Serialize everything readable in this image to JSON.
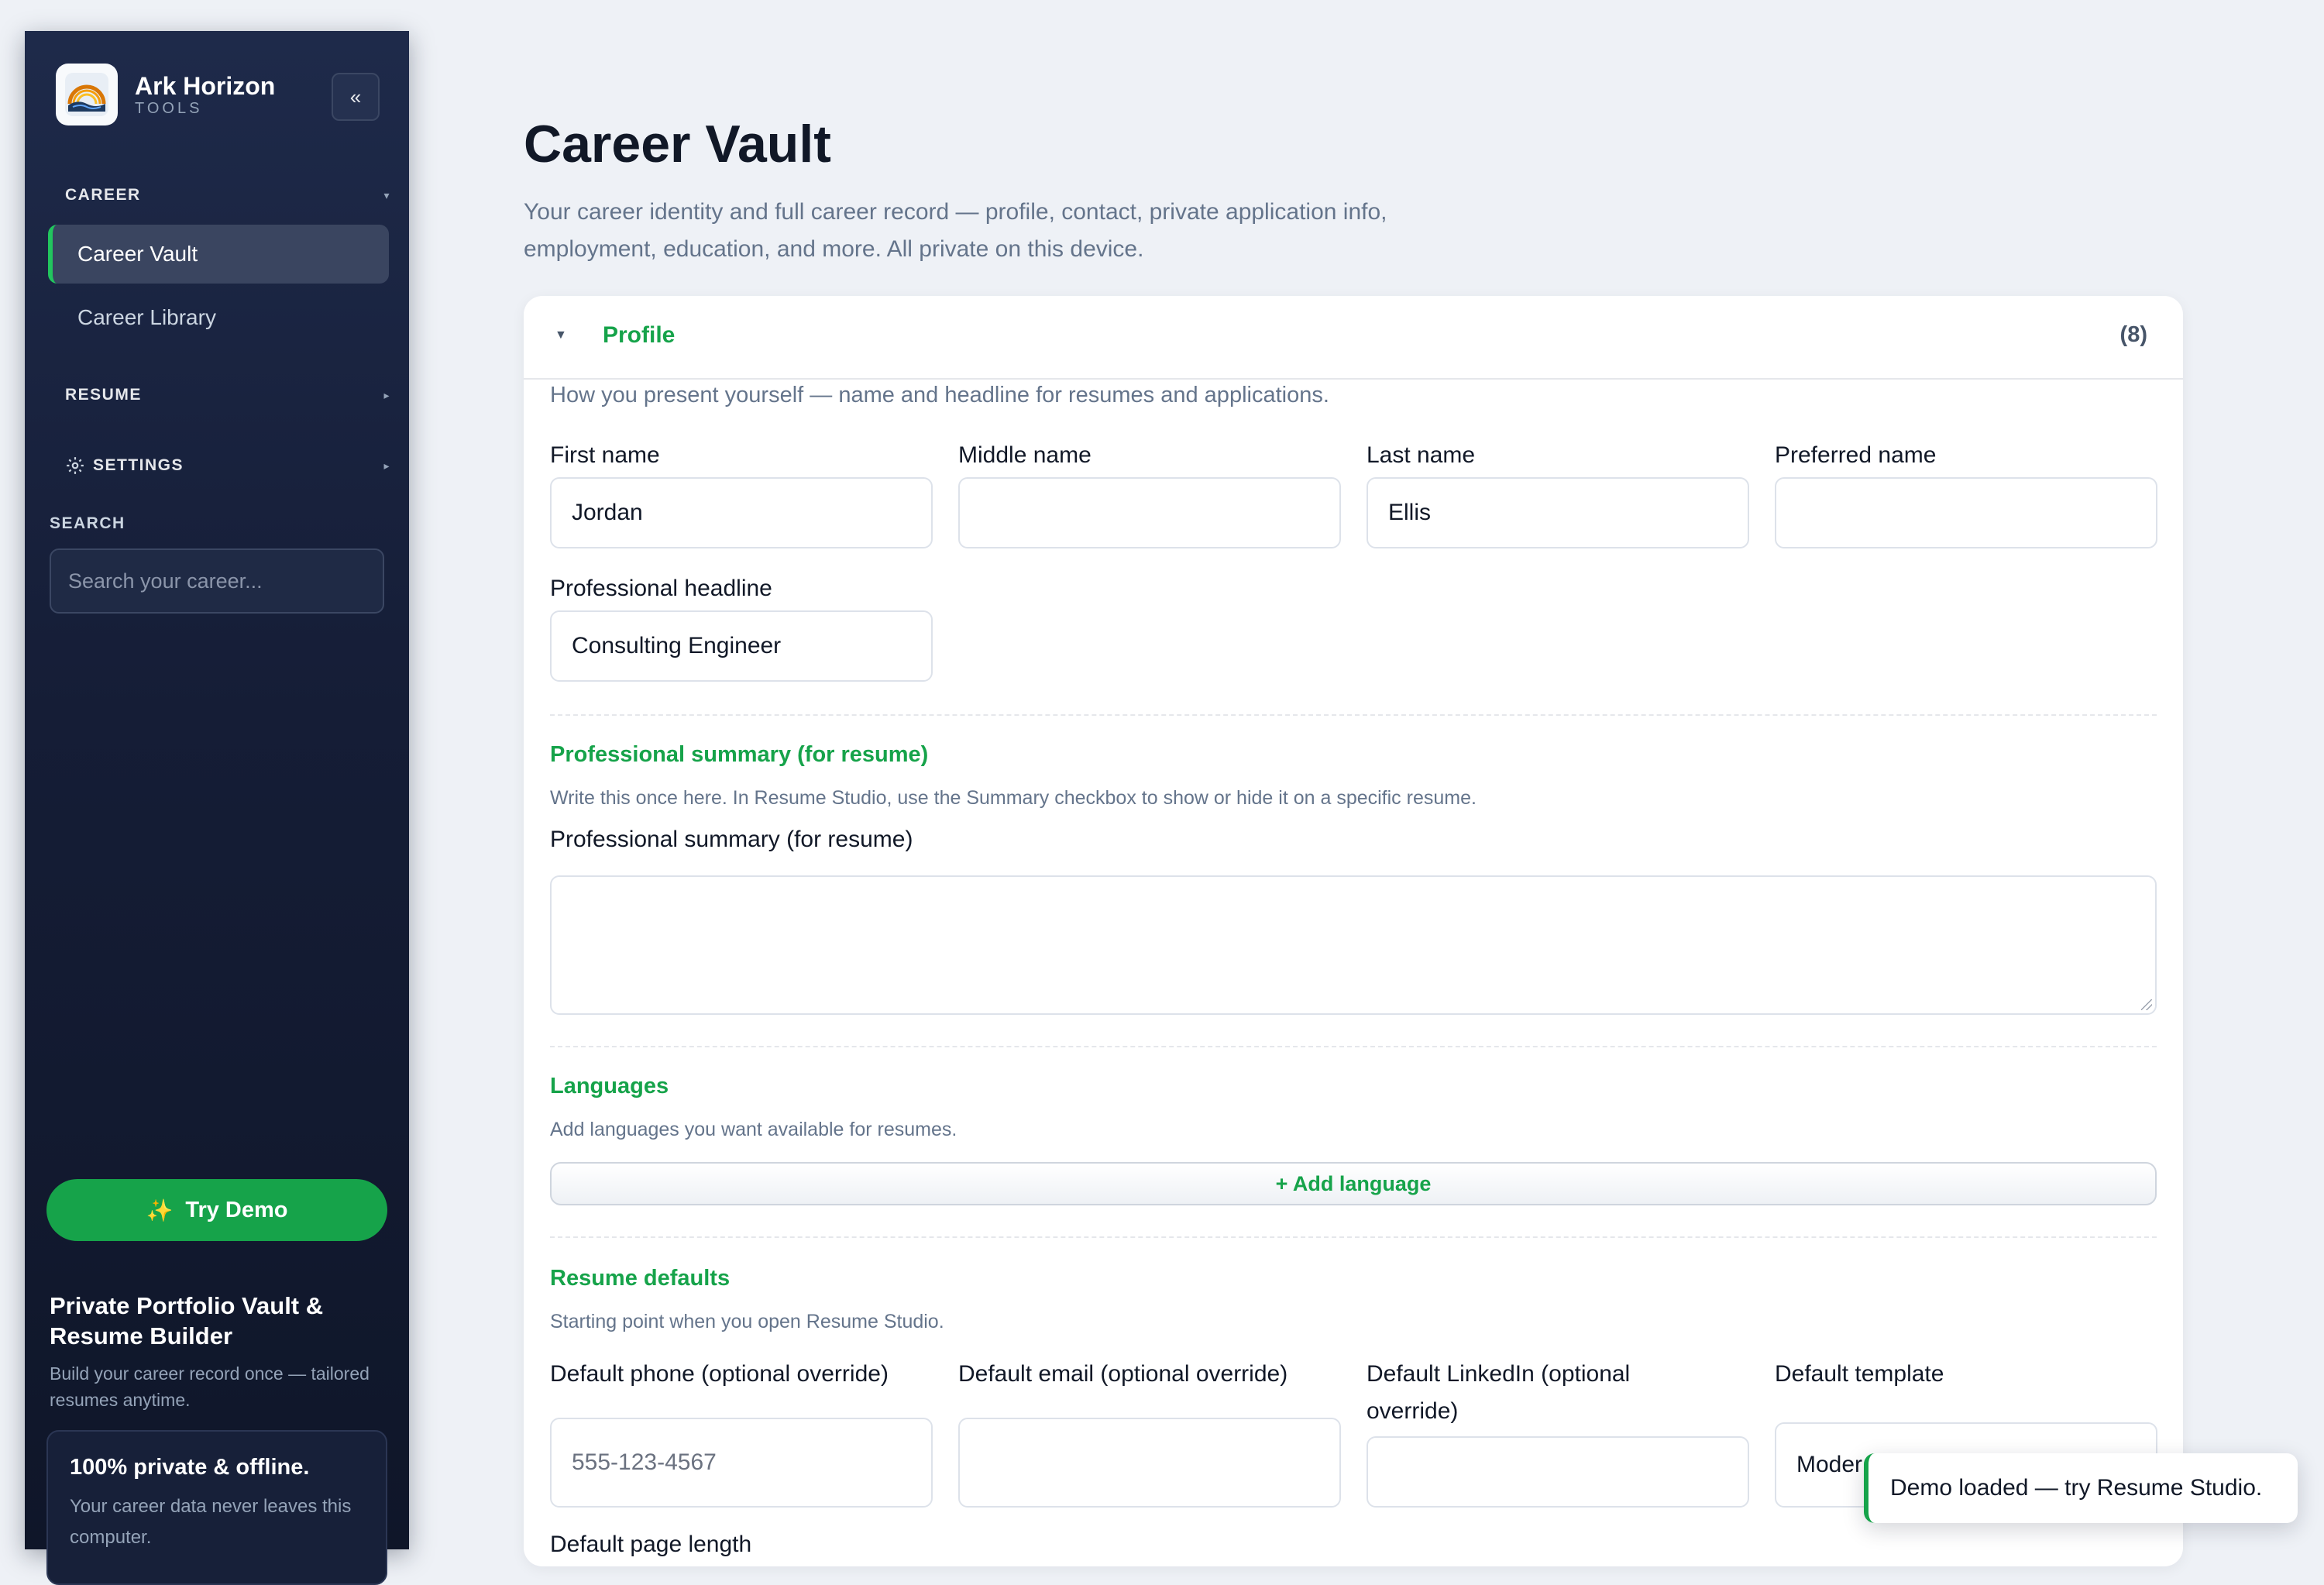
{
  "sidebar": {
    "brand_name": "Ark Horizon",
    "brand_sub": "TOOLS",
    "collapse_label": "«",
    "sections": {
      "career": "CAREER",
      "resume": "RESUME",
      "settings": "SETTINGS",
      "search": "SEARCH"
    },
    "items": [
      {
        "label": "Career Vault",
        "active": true
      },
      {
        "label": "Career Library",
        "active": false
      }
    ],
    "search_placeholder": "Search your career...",
    "try_demo": "Try Demo",
    "promo_title": "Private Portfolio Vault & Resume Builder",
    "promo_desc": "Build your career record once — tailored resumes anytime.",
    "private_title": "100% private & offline.",
    "private_desc": "Your career data never leaves this computer.",
    "accent_color": "#22c55e"
  },
  "main": {
    "title": "Career Vault",
    "description": "Your career identity and full career record — profile, contact, private application info, employment, education, and more. All private on this device."
  },
  "profile": {
    "title": "Profile",
    "count": "(8)",
    "intro": "How you present yourself — name and headline for resumes and applications.",
    "fields": {
      "first_name": {
        "label": "First name",
        "value": "Jordan"
      },
      "middle_name": {
        "label": "Middle name",
        "value": ""
      },
      "last_name": {
        "label": "Last name",
        "value": "Ellis"
      },
      "preferred_name": {
        "label": "Preferred name",
        "value": ""
      },
      "headline": {
        "label": "Professional headline",
        "value": "Consulting Engineer"
      }
    },
    "summary": {
      "title": "Professional summary (for resume)",
      "desc": "Write this once here. In Resume Studio, use the Summary checkbox to show or hide it on a specific resume.",
      "label": "Professional summary (for resume)",
      "value": ""
    },
    "languages": {
      "title": "Languages",
      "desc": "Add languages you want available for resumes.",
      "add_button": "+ Add language"
    },
    "resume_defaults": {
      "title": "Resume defaults",
      "desc": "Starting point when you open Resume Studio.",
      "phone": {
        "label": "Default phone (optional override)",
        "placeholder": "555-123-4567"
      },
      "email": {
        "label": "Default email (optional override)",
        "value": ""
      },
      "linkedin": {
        "label": "Default LinkedIn (optional override)",
        "value": ""
      },
      "template": {
        "label": "Default template",
        "value": "Moder"
      },
      "page_length": {
        "label": "Default page length"
      }
    }
  },
  "toast": {
    "message": "Demo loaded — try Resume Studio.",
    "color": "#16a34a"
  }
}
